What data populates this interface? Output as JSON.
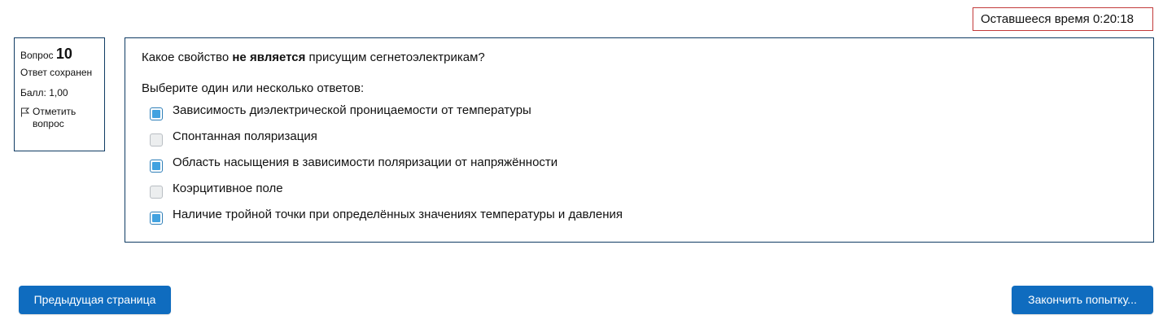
{
  "timer": {
    "text": "Оставшееся время 0:20:18"
  },
  "question_info": {
    "label": "Вопрос",
    "number": "10",
    "state": "Ответ сохранен",
    "grade": "Балл: 1,00",
    "flag_label": "Отметить вопрос"
  },
  "question": {
    "text_before": "Какое свойство ",
    "text_bold": "не является",
    "text_after": " присущим сегнетоэлектрикам?",
    "prompt": "Выберите один или несколько ответов:",
    "answers": [
      {
        "label": "Зависимость диэлектрической проницаемости от температуры",
        "checked": true
      },
      {
        "label": "Спонтанная поляризация",
        "checked": false
      },
      {
        "label": "Область насыщения в зависимости поляризации от напряжённости",
        "checked": true
      },
      {
        "label": "Коэрцитивное поле",
        "checked": false
      },
      {
        "label": "Наличие тройной точки при определённых значениях температуры и давления",
        "checked": true
      }
    ]
  },
  "navigation": {
    "prev_label": "Предыдущая страница",
    "finish_label": "Закончить попытку..."
  },
  "colors": {
    "accent": "#0f6cbf",
    "border": "#0f3b63",
    "timer_border": "#c23a3a",
    "checkbox_fill": "#42a2e0"
  }
}
